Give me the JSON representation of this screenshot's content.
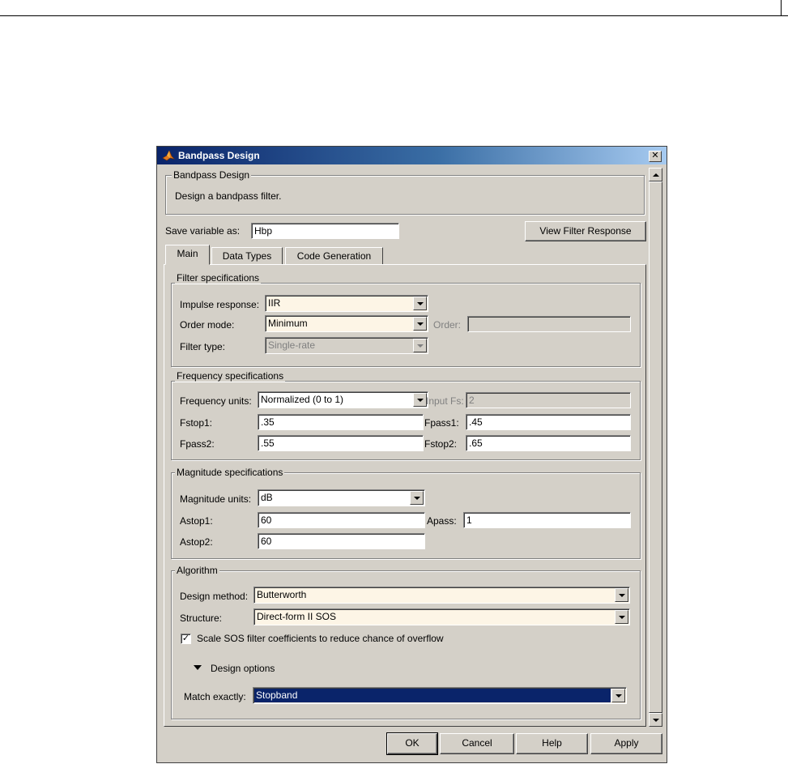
{
  "window": {
    "title": "Bandpass Design",
    "close_glyph": "✕"
  },
  "header_group": {
    "title": "Bandpass Design",
    "description": "Design a bandpass filter."
  },
  "save_variable": {
    "label": "Save variable as:",
    "value": "Hbp"
  },
  "view_response_button": "View Filter Response",
  "tabs": [
    {
      "label": "Main",
      "active": true
    },
    {
      "label": "Data Types",
      "active": false
    },
    {
      "label": "Code Generation",
      "active": false
    }
  ],
  "filter_specs": {
    "title": "Filter specifications",
    "impulse_label": "Impulse response:",
    "impulse_value": "IIR",
    "order_mode_label": "Order mode:",
    "order_mode_value": "Minimum",
    "order_label": "Order:",
    "order_value": "",
    "filter_type_label": "Filter type:",
    "filter_type_value": "Single-rate"
  },
  "freq_specs": {
    "title": "Frequency specifications",
    "units_label": "Frequency units:",
    "units_value": "Normalized (0 to 1)",
    "input_fs_label": "Input Fs:",
    "input_fs_value": "2",
    "fstop1_label": "Fstop1:",
    "fstop1_value": ".35",
    "fpass1_label": "Fpass1:",
    "fpass1_value": ".45",
    "fpass2_label": "Fpass2:",
    "fpass2_value": ".55",
    "fstop2_label": "Fstop2:",
    "fstop2_value": ".65"
  },
  "mag_specs": {
    "title": "Magnitude specifications",
    "units_label": "Magnitude units:",
    "units_value": "dB",
    "astop1_label": "Astop1:",
    "astop1_value": "60",
    "apass_label": "Apass:",
    "apass_value": "1",
    "astop2_label": "Astop2:",
    "astop2_value": "60"
  },
  "algorithm": {
    "title": "Algorithm",
    "method_label": "Design method:",
    "method_value": "Butterworth",
    "structure_label": "Structure:",
    "structure_value": "Direct-form II SOS",
    "scale_label": "Scale SOS filter coefficients to reduce chance of overflow",
    "scale_checked": true,
    "check_glyph": "✓",
    "design_options_label": "Design options",
    "match_label": "Match exactly:",
    "match_value": "Stopband"
  },
  "buttons": {
    "ok": "OK",
    "cancel": "Cancel",
    "help": "Help",
    "apply": "Apply"
  },
  "colors": {
    "title_start": "#0a246a",
    "title_end": "#a6caf0",
    "face": "#d4d0c8",
    "combo_bg": "#fdf5e6",
    "selection": "#0a246a"
  }
}
